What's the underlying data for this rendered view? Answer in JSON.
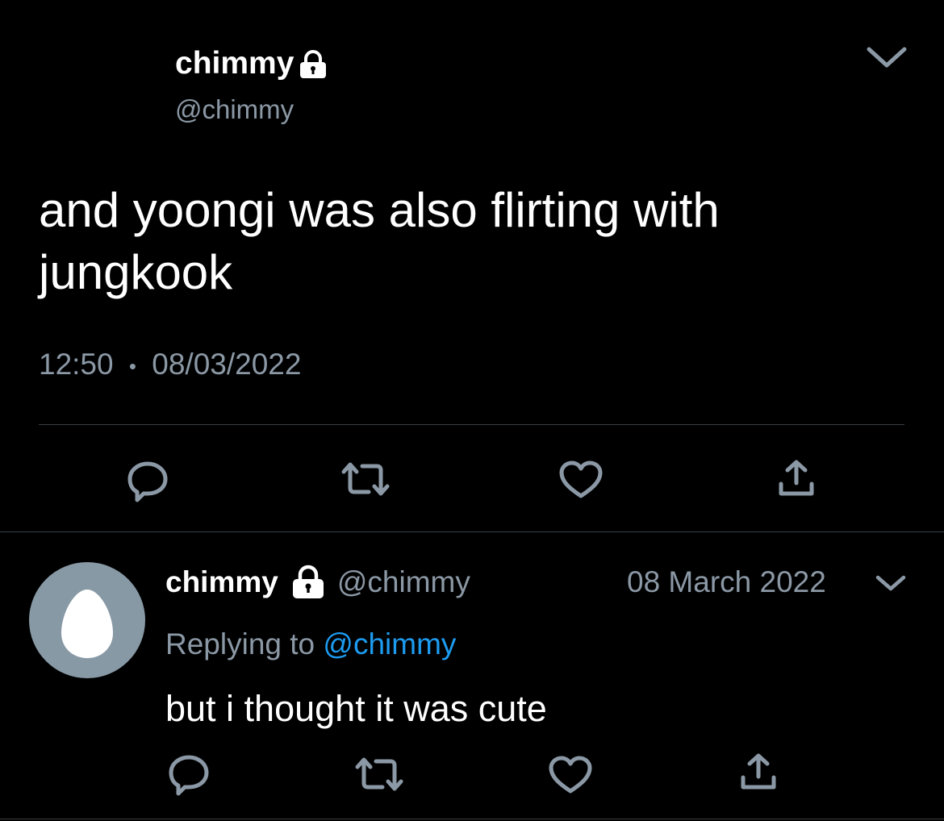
{
  "colors": {
    "background": "#000000",
    "text": "#ffffff",
    "muted": "#8b98a5",
    "link": "#1d9bf0",
    "divider": "#3a3f44",
    "avatar_bg": "#8899a6"
  },
  "main_tweet": {
    "display_name": "chimmy",
    "handle": "@chimmy",
    "text_line_1": "and yoongi was also flirting with",
    "text_line_2": "jungkook",
    "time": "12:50",
    "separator": "•",
    "date": "08/03/2022",
    "icons": [
      "lock-icon",
      "chevron-down-icon",
      "reply-icon",
      "retweet-icon",
      "like-icon",
      "share-icon"
    ]
  },
  "reply_tweet": {
    "display_name": "chimmy",
    "handle": "@chimmy",
    "date": "08 March 2022",
    "replying_prefix": "Replying to",
    "replying_handle": "@chimmy",
    "text": "but i thought it was cute",
    "icons": [
      "egg-avatar",
      "lock-icon",
      "chevron-down-icon",
      "reply-icon",
      "retweet-icon",
      "like-icon",
      "share-icon"
    ]
  }
}
